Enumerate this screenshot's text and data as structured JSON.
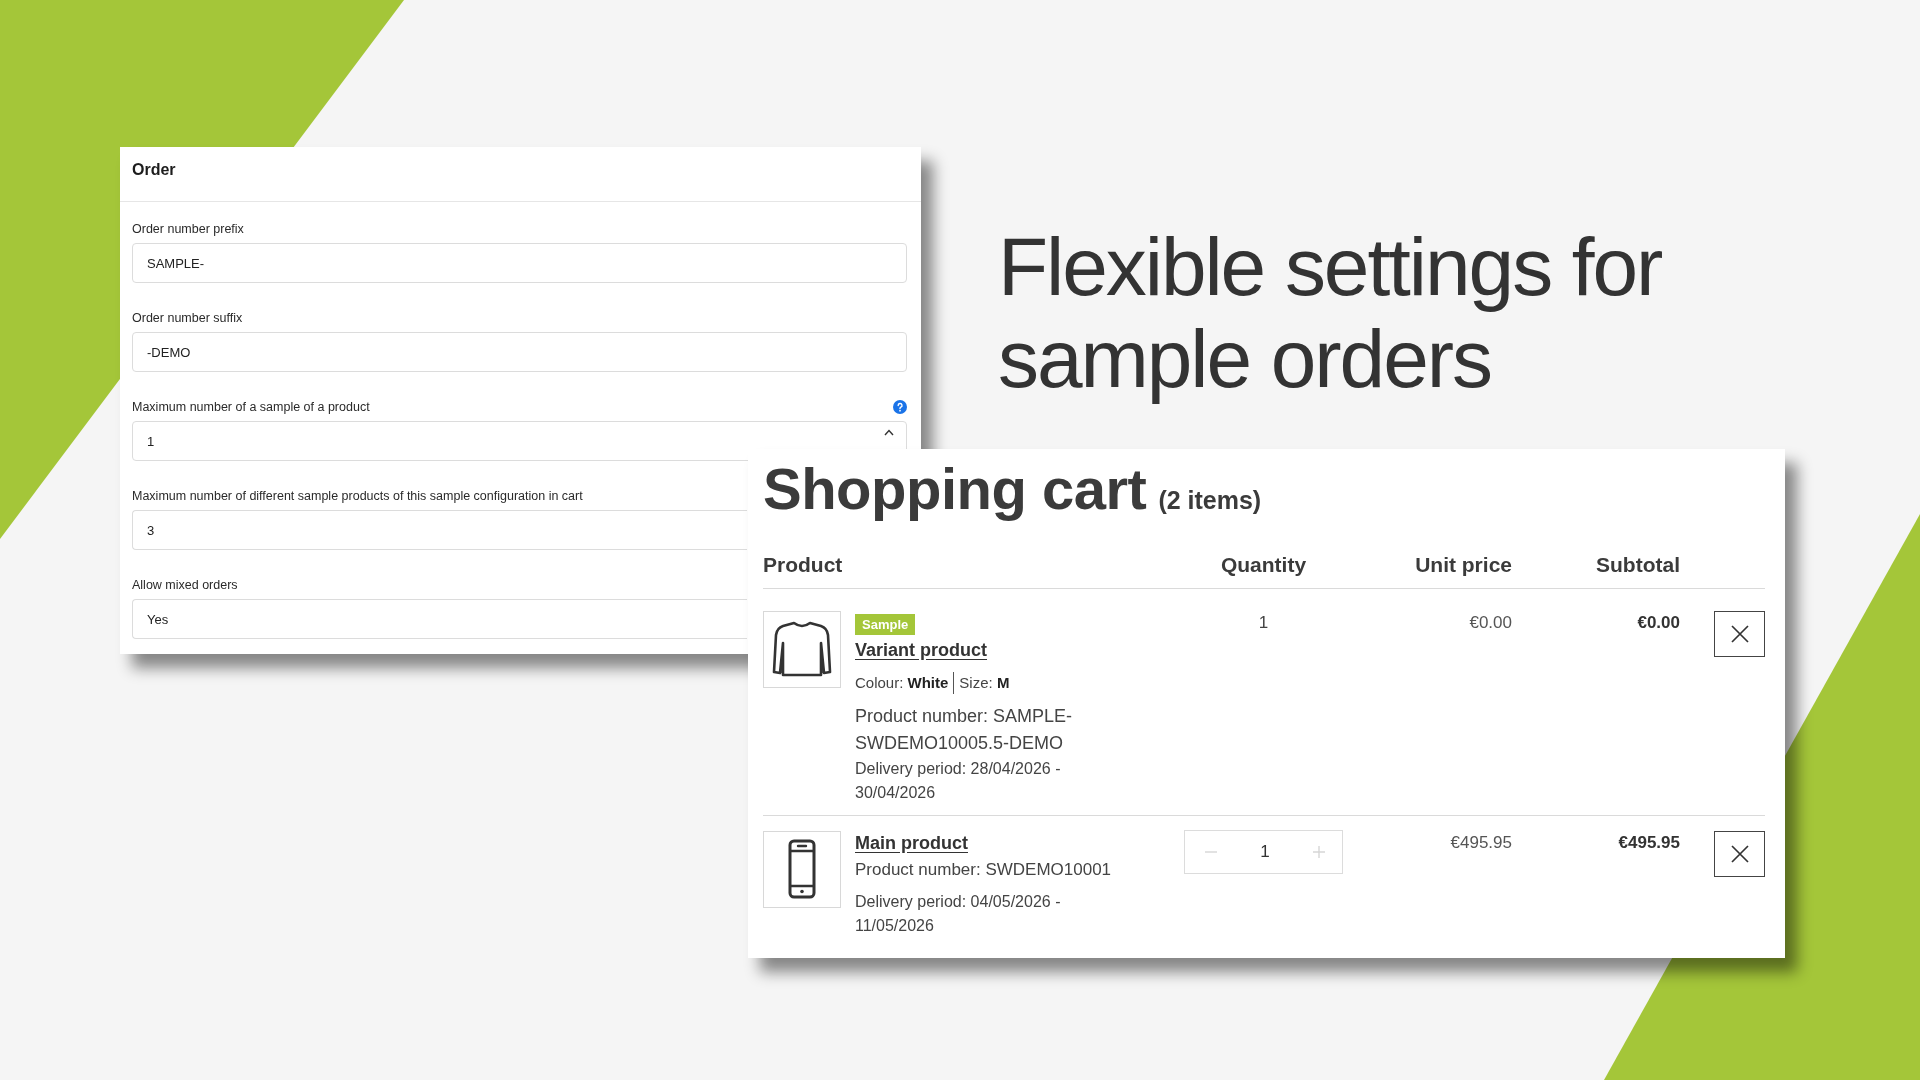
{
  "order": {
    "title": "Order",
    "fields": [
      {
        "kind": "text",
        "label": "Order number prefix",
        "value": "SAMPLE-",
        "help": false
      },
      {
        "kind": "text",
        "label": "Order number suffix",
        "value": "-DEMO",
        "help": false
      },
      {
        "kind": "number",
        "label": "Maximum number of a sample of a product",
        "value": "1",
        "help": true
      },
      {
        "kind": "text",
        "label": "Maximum number of different sample products of this sample configuration in cart",
        "value": "3",
        "help": false
      },
      {
        "kind": "text",
        "label": "Allow mixed orders",
        "value": "Yes",
        "help": false
      }
    ]
  },
  "headline": "Flexible settings for sample orders",
  "cart": {
    "title": "Shopping cart",
    "count": "(2 items)",
    "columns": [
      "Product",
      "Quantity",
      "Unit price",
      "Subtotal"
    ],
    "rows": [
      {
        "badge": "Sample",
        "name": "Variant product",
        "attributes": [
          "Colour: **White**",
          "Size: **M**"
        ],
        "product_number": "Product number: SAMPLE-SWDEMO10005.5-DEMO",
        "delivery": "Delivery period: 28/04/2026 - 30/04/2026",
        "quantity": {
          "kind": "text",
          "value": "1"
        },
        "unit_price": "€0.00",
        "subtotal": "€0.00"
      },
      {
        "name": "Main product",
        "product_number": "Product number: SWDEMO10001",
        "delivery": "Delivery period: 04/05/2026 - 11/05/2026",
        "quantity": {
          "kind": "stepper",
          "value": "1"
        },
        "unit_price": "€495.95",
        "subtotal": "€495.95"
      }
    ]
  }
}
